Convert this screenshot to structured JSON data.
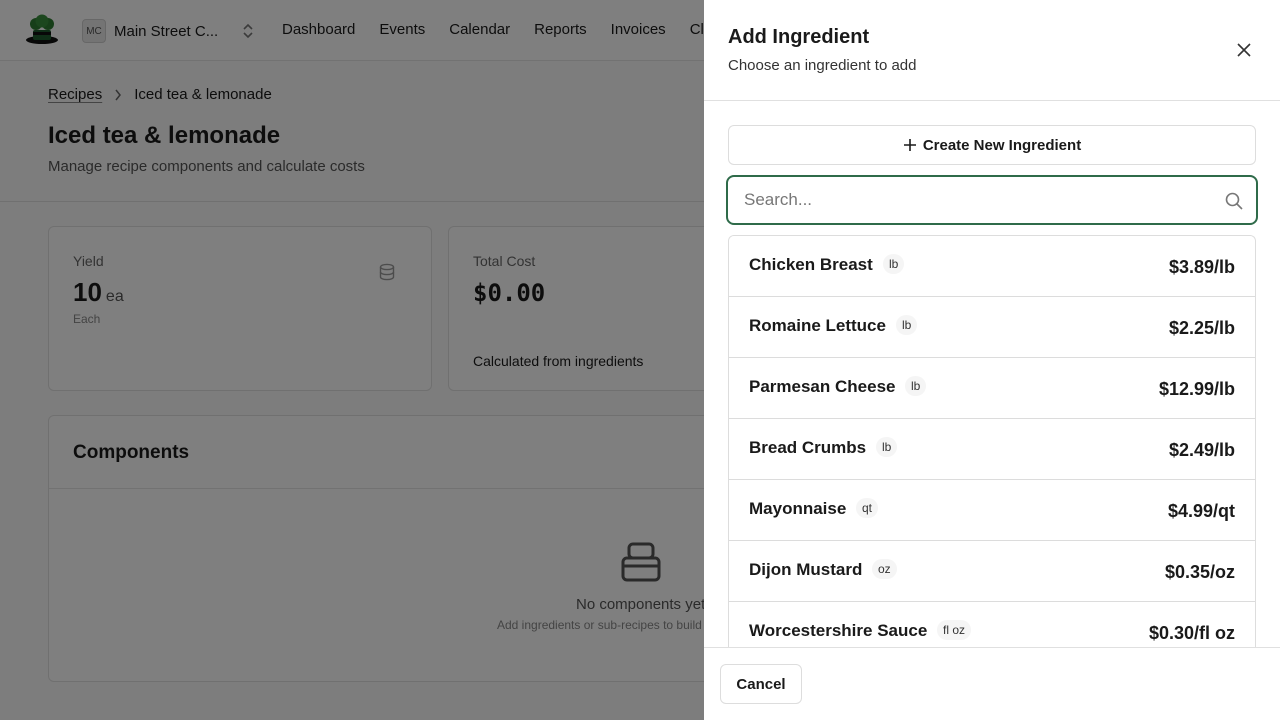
{
  "topbar": {
    "org_initials": "MC",
    "org_name": "Main Street C...",
    "nav": [
      "Dashboard",
      "Events",
      "Calendar",
      "Reports",
      "Invoices",
      "Cl"
    ]
  },
  "breadcrumb": {
    "parent": "Recipes",
    "current": "Iced tea & lemonade"
  },
  "page": {
    "title": "Iced tea & lemonade",
    "subtitle": "Manage recipe components and calculate costs"
  },
  "yield_card": {
    "label": "Yield",
    "value": "10",
    "unit": "ea",
    "description": "Each"
  },
  "cost_card": {
    "label": "Total Cost",
    "value": "$0.00",
    "note": "Calculated from ingredients"
  },
  "components": {
    "title": "Components",
    "empty_title": "No components yet",
    "empty_subtitle": "Add ingredients or sub-recipes to build this recipe"
  },
  "drawer": {
    "title": "Add Ingredient",
    "subtitle": "Choose an ingredient to add",
    "create_label": "Create New Ingredient",
    "search_placeholder": "Search...",
    "cancel_label": "Cancel",
    "ingredients": [
      {
        "name": "Chicken Breast",
        "unit": "lb",
        "price": "$3.89/lb"
      },
      {
        "name": "Romaine Lettuce",
        "unit": "lb",
        "price": "$2.25/lb"
      },
      {
        "name": "Parmesan Cheese",
        "unit": "lb",
        "price": "$12.99/lb"
      },
      {
        "name": "Bread Crumbs",
        "unit": "lb",
        "price": "$2.49/lb"
      },
      {
        "name": "Mayonnaise",
        "unit": "qt",
        "price": "$4.99/qt"
      },
      {
        "name": "Dijon Mustard",
        "unit": "oz",
        "price": "$0.35/oz"
      },
      {
        "name": "Worcestershire Sauce",
        "unit": "fl oz",
        "price": "$0.30/fl oz"
      }
    ]
  },
  "colors": {
    "accent": "#2f6b4a",
    "overlay": "rgba(0,0,0,0.5)"
  }
}
